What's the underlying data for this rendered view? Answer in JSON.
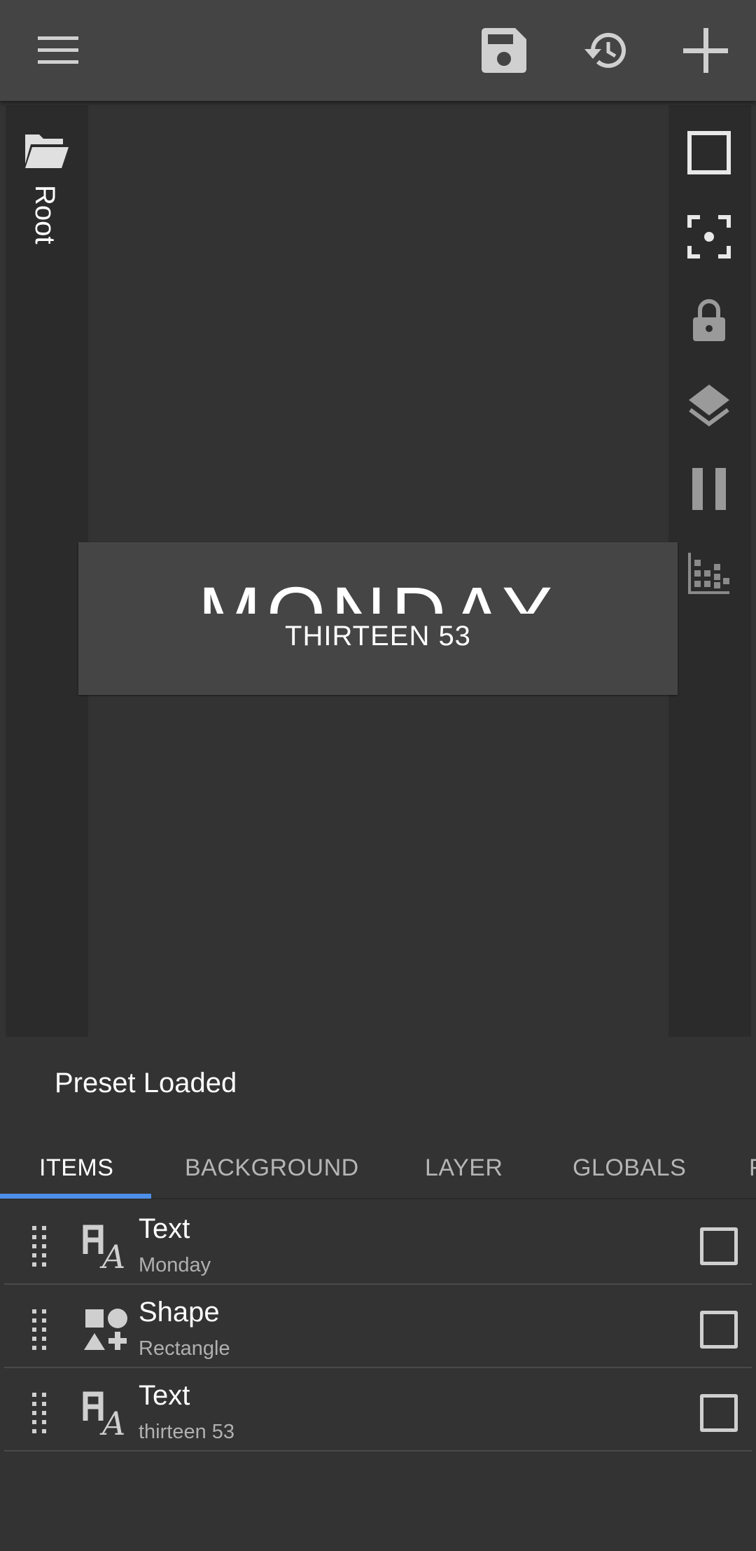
{
  "toolbar": {
    "menu_icon": "menu-icon",
    "save_icon": "save-icon",
    "history_icon": "history-icon",
    "add_icon": "add-icon"
  },
  "left_panel": {
    "folder_icon": "folder-open-icon",
    "label": "Root"
  },
  "right_tools": [
    "select-box-icon",
    "center-focus-icon",
    "lock-icon",
    "layers-icon",
    "pause-icon",
    "stats-chart-icon"
  ],
  "preview": {
    "title": "MONDAY",
    "subtitle": "THIRTEEN 53"
  },
  "status": "Preset Loaded",
  "tabs": [
    {
      "label": "ITEMS",
      "active": true
    },
    {
      "label": "BACKGROUND"
    },
    {
      "label": "LAYER"
    },
    {
      "label": "GLOBALS"
    },
    {
      "label": "F"
    }
  ],
  "items": [
    {
      "type": "Text",
      "name": "Monday",
      "icon": "text-type-icon"
    },
    {
      "type": "Shape",
      "name": "Rectangle",
      "icon": "shapes-icon"
    },
    {
      "type": "Text",
      "name": "thirteen 53",
      "icon": "text-type-icon"
    }
  ],
  "colors": {
    "accent": "#4d8fe8",
    "appbar": "#444444",
    "background": "#333333",
    "sidebar": "#2b2b2b"
  }
}
